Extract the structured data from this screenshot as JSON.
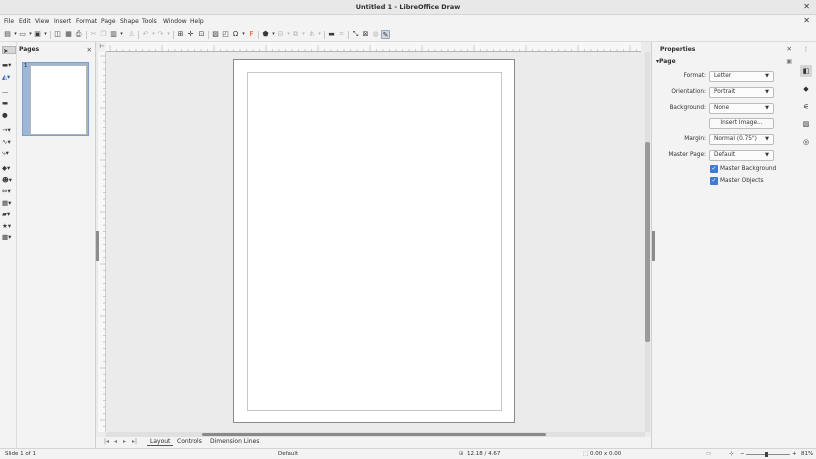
{
  "window": {
    "title": "Untitled 1 - LibreOffice Draw",
    "close_glyph": "✕"
  },
  "menu": {
    "items": [
      "File",
      "Edit",
      "View",
      "Insert",
      "Format",
      "Page",
      "Shape",
      "Tools",
      "Window",
      "Help"
    ],
    "doc_close": "✕"
  },
  "pages_pane": {
    "title": "Pages",
    "close": "✕",
    "thumb_number": "1"
  },
  "ruler": {
    "corner_glyph": "⊢"
  },
  "tabs": {
    "nav": [
      "|◂",
      "◂",
      "▸",
      "▸|"
    ],
    "items": [
      "Layout",
      "Controls",
      "Dimension Lines"
    ],
    "active": "Layout"
  },
  "sidebar": {
    "title": "Properties",
    "close": "✕",
    "section": "Page",
    "format_label": "Format:",
    "format_value": "Letter",
    "orientation_label": "Orientation:",
    "orientation_value": "Portrait",
    "background_label": "Background:",
    "background_value": "None",
    "insert_image": "Insert Image...",
    "margin_label": "Margin:",
    "margin_value": "Normal (0.75\")",
    "master_page_label": "Master Page:",
    "master_page_value": "Default",
    "master_background": "Master Background",
    "master_objects": "Master Objects"
  },
  "status": {
    "slide": "Slide 1 of 1",
    "master": "Default",
    "position": "12.18 / 4.67",
    "size": "0.00 x 0.00",
    "zoom": "81%"
  },
  "icons": {
    "toolbar": [
      "new-icon",
      "open-icon",
      "save-icon",
      "export-pdf-icon",
      "print-icon",
      "cut-icon",
      "copy-icon",
      "paste-icon",
      "clone-formatting-icon",
      "undo-icon",
      "redo-icon",
      "grid-icon",
      "helplines-icon",
      "image-icon",
      "textbox-icon",
      "special-char-icon",
      "fontwork-icon",
      "transform-icon",
      "align-icon",
      "arrange-icon",
      "distribute-icon",
      "shadow-icon",
      "crop-icon",
      "toggle-points-icon",
      "glue-points-icon",
      "extrusion-icon",
      "draw-functions-icon"
    ],
    "deck": [
      "properties-deck-icon",
      "styles-deck-icon",
      "gallery-deck-icon",
      "navigator-deck-icon",
      "shapes-deck-icon"
    ]
  },
  "colors": {
    "accent": "#3d7cd6",
    "selection": "#9fb7d6"
  }
}
